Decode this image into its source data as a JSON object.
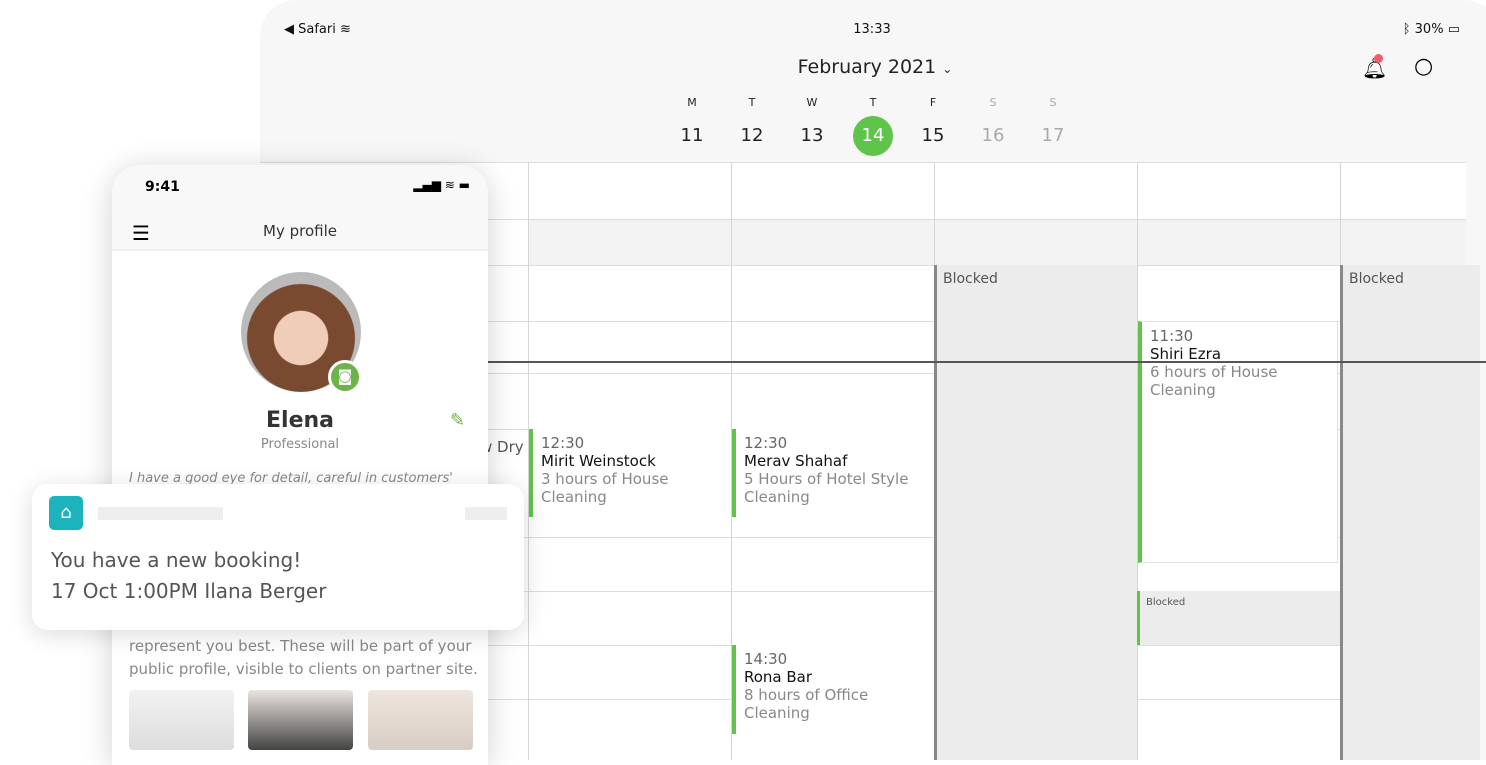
{
  "tablet": {
    "status": {
      "app": "Safari",
      "time": "13:33",
      "battery": "30%"
    },
    "month": "February 2021",
    "days": [
      {
        "w": "M",
        "n": "11"
      },
      {
        "w": "T",
        "n": "12"
      },
      {
        "w": "W",
        "n": "13"
      },
      {
        "w": "T",
        "n": "14",
        "selected": true
      },
      {
        "w": "F",
        "n": "15"
      },
      {
        "w": "S",
        "n": "16"
      },
      {
        "w": "S",
        "n": "17"
      }
    ],
    "blocked": "Blocked",
    "events": [
      {
        "time": "12:30",
        "name": "Mirit Weinstock",
        "desc": "3 hours of House Cleaning"
      },
      {
        "time": "12:30",
        "name": "Merav Shahaf",
        "desc": "5 Hours of Hotel Style Cleaning"
      },
      {
        "time": "14:30",
        "name": "Rona Bar",
        "desc": "8 hours of Office Cleaning"
      },
      {
        "time": "11:30",
        "name": "Shiri Ezra",
        "desc": "6 hours of House Cleaning"
      }
    ],
    "partial_text": "w Dry",
    "accent": "#5ec54a"
  },
  "phone": {
    "time": "9:41",
    "title": "My profile",
    "name": "Elena",
    "role": "Professional",
    "bio": "I have a good eye for detail, careful in customers'",
    "desc": "represent you best. These will be part of your public profile, visible to clients on partner site."
  },
  "notification": {
    "line1": "You have a new booking!",
    "line2": "17 Oct 1:00PM Ilana Berger",
    "brand": "#1db3bd"
  }
}
